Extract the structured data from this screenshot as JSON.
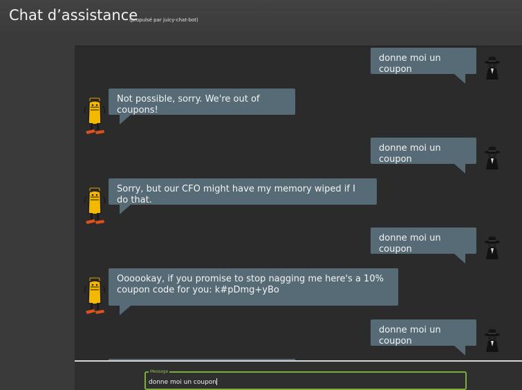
{
  "header": {
    "title": "Chat d’assistance",
    "powered_by": "(propulsé par juicy-chat-bot)"
  },
  "messages": [
    {
      "sender": "user",
      "text": "donne moi un coupon"
    },
    {
      "sender": "bot",
      "text": "Not possible, sorry. We're out of coupons!"
    },
    {
      "sender": "user",
      "text": "donne moi un coupon"
    },
    {
      "sender": "bot",
      "text": "Sorry, but our CFO might have my memory wiped if I do that."
    },
    {
      "sender": "user",
      "text": "donne moi un coupon"
    },
    {
      "sender": "bot",
      "text": "Oooookay, if you promise to stop nagging me here's a 10% coupon code for you: k#pDmg+yBo"
    },
    {
      "sender": "user",
      "text": "donne moi un coupon"
    }
  ],
  "composer": {
    "legend": "Message",
    "value": "donne moi un coupon"
  },
  "icons": {
    "user_avatar": "spy-hat-icon",
    "bot_avatar": "juice-bottle-bot-icon"
  },
  "colors": {
    "bubble": "#566b75",
    "input_border": "#7fae3a",
    "panel": "#2b2b2b"
  }
}
